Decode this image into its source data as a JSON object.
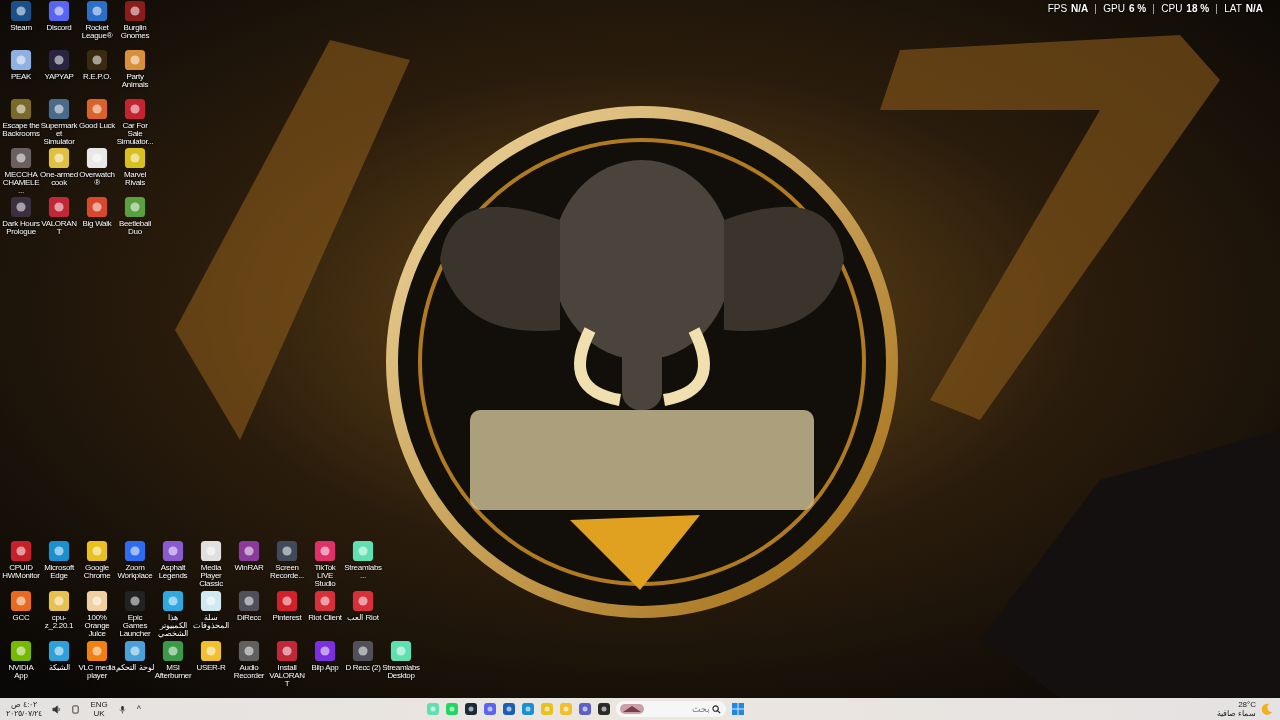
{
  "performance_overlay": {
    "metrics": [
      {
        "label": "FPS",
        "value": "N/A"
      },
      {
        "label": "GPU",
        "value": "6 %"
      },
      {
        "label": "CPU",
        "value": "18 %"
      },
      {
        "label": "LAT",
        "value": "N/A"
      }
    ]
  },
  "desktop_icons_top": [
    {
      "label": "Steam",
      "color": "#1b4f8a"
    },
    {
      "label": "Discord",
      "color": "#5865f2"
    },
    {
      "label": "Rocket League®",
      "color": "#2a6fc9"
    },
    {
      "label": "Burglin Gnomes",
      "color": "#8a1c1c"
    },
    {
      "label": "PEAK",
      "color": "#8fb0e0"
    },
    {
      "label": "YAPYAP",
      "color": "#2a2440"
    },
    {
      "label": "R.E.P.O.",
      "color": "#3a2a10"
    },
    {
      "label": "Party Animals",
      "color": "#d9903a"
    },
    {
      "label": "Escape the Backrooms",
      "color": "#7a6a2a"
    },
    {
      "label": "Supermarket Simulator",
      "color": "#4a6a8a"
    },
    {
      "label": "Good Luck",
      "color": "#d9622a"
    },
    {
      "label": "Car For Sale Simulator...",
      "color": "#c4242f"
    },
    {
      "label": "MECCHA CHAMELE...",
      "color": "#6a6060"
    },
    {
      "label": "One-armed cook",
      "color": "#e0c040"
    },
    {
      "label": "Overwatch®",
      "color": "#e8e8e8"
    },
    {
      "label": "Marvel Rivals",
      "color": "#d8c020"
    },
    {
      "label": "Dark Hours Prologue",
      "color": "#3a3040"
    },
    {
      "label": "VALORANT",
      "color": "#c0283a"
    },
    {
      "label": "Big Walk",
      "color": "#d8482a"
    },
    {
      "label": "Beetleball Duo",
      "color": "#5aa040"
    }
  ],
  "desktop_icons_bottom": [
    [
      {
        "label": "CPUID HWMonitor",
        "color": "#c8202a"
      },
      {
        "label": "Microsoft Edge",
        "color": "#1a90d0"
      },
      {
        "label": "Google Chrome",
        "color": "#e8c020"
      },
      {
        "label": "Zoom Workplace",
        "color": "#2d6cf0"
      },
      {
        "label": "Asphalt Legends",
        "color": "#8a5ad0"
      },
      {
        "label": "Media Player Classic",
        "color": "#e0e0e0"
      },
      {
        "label": "WinRAR",
        "color": "#8a3a9a"
      },
      {
        "label": "Screen Recorde...",
        "color": "#404a5a"
      },
      {
        "label": "TikTok LIVE Studio",
        "color": "#e0306a"
      },
      {
        "label": "Streamlabs...",
        "color": "#60e0b0"
      }
    ],
    [
      {
        "label": "GCC",
        "color": "#e86a20"
      },
      {
        "label": "cpu-z_2.20.1",
        "color": "#e8c050"
      },
      {
        "label": "100% Orange Juice",
        "color": "#f0d0a0"
      },
      {
        "label": "Epic Games Launcher",
        "color": "#222222"
      },
      {
        "label": "هذا الكمبيوتر الشخصي",
        "color": "#30a8e0"
      },
      {
        "label": "سلة المحذوفات",
        "color": "#d0e8f0"
      },
      {
        "label": "DiRecc",
        "color": "#50505a"
      },
      {
        "label": "Pinterest",
        "color": "#d0202a"
      },
      {
        "label": "Riot Client",
        "color": "#d8303a"
      },
      {
        "label": "العب Riot",
        "color": "#d8303a"
      }
    ],
    [
      {
        "label": "NVIDIA App",
        "color": "#76b900"
      },
      {
        "label": "الشبكة",
        "color": "#30a0d8"
      },
      {
        "label": "VLC media player",
        "color": "#f08010"
      },
      {
        "label": "لوحة التحكم",
        "color": "#4aa0d8"
      },
      {
        "label": "MSI Afterburner",
        "color": "#3a9a4a"
      },
      {
        "label": "USER-R",
        "color": "#f0c030"
      },
      {
        "label": "Audio Recorder",
        "color": "#606060"
      },
      {
        "label": "Install VALORANT",
        "color": "#c0283a"
      },
      {
        "label": "Blip App",
        "color": "#7a30e0"
      },
      {
        "label": "D Recc (2)",
        "color": "#50505a"
      },
      {
        "label": "Streamlabs Desktop",
        "color": "#60e0b0"
      }
    ]
  ],
  "taskbar": {
    "clock": {
      "time": "٤:٠٢ ص",
      "date": "٢٠٢٥/٠٧/٢٤"
    },
    "language": {
      "code": "ENG",
      "region": "UK"
    },
    "tray_chevron": "^",
    "pinned_apps": [
      {
        "color": "#60e0b0"
      },
      {
        "color": "#1ed760"
      },
      {
        "color": "#1b2838"
      },
      {
        "color": "#5865f2"
      },
      {
        "color": "#1a5fb4"
      },
      {
        "color": "#1a90d0"
      },
      {
        "color": "#e8c020"
      },
      {
        "color": "#f0c030"
      },
      {
        "color": "#5b5fc7"
      },
      {
        "color": "#2a2a2a"
      }
    ],
    "search": {
      "placeholder": "بحث"
    },
    "weather": {
      "temperature": "28°C",
      "condition": "سماء صافية"
    }
  }
}
